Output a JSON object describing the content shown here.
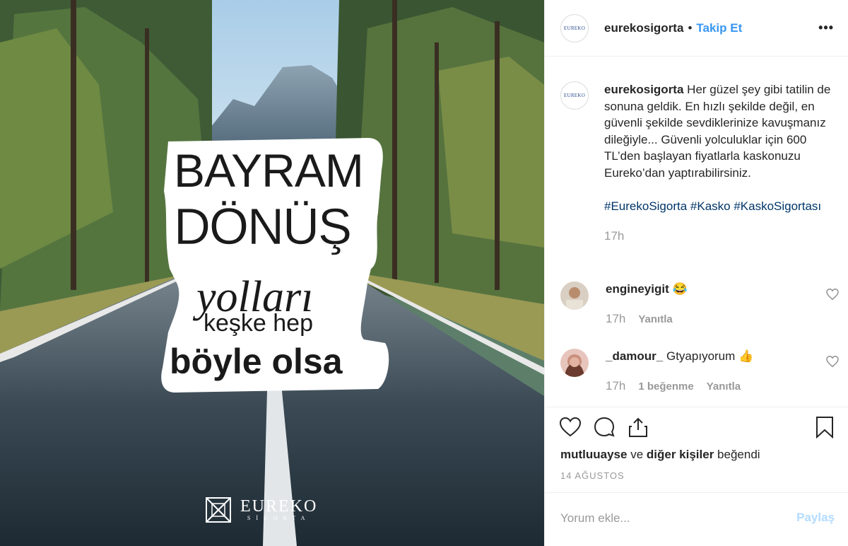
{
  "post": {
    "image_text": {
      "line1": "BAYRAM",
      "line2": "DÖNÜŞ",
      "line3": "yolları",
      "line4": "keşke hep",
      "line5": "böyle olsa"
    },
    "brand": {
      "name": "EUREKO",
      "sub": "SİGORTA"
    }
  },
  "header": {
    "avatar_text": "EUREKO",
    "username": "eurekosigorta",
    "separator": "•",
    "follow_label": "Takip Et",
    "more_icon": "more-horizontal-icon",
    "more_glyph": "•••"
  },
  "caption": {
    "username": "eurekosigorta",
    "text": "Her güzel şey gibi tatilin de sonuna geldik. En hızlı şekilde değil, en güvenli şekilde sevdiklerinize kavuşmanız dileğiyle... Güvenli yolculuklar için 600 TL’den başlayan fiyatlarla kaskonuzu Eureko’dan yaptırabilirsiniz.",
    "hashtags": "#EurekoSigorta #Kasko #KaskoSigortası",
    "time": "17h"
  },
  "comments": [
    {
      "username": "engineyigit",
      "text": "😂",
      "time": "17h",
      "likes": "",
      "reply_label": "Yanıtla"
    },
    {
      "username": "_damour_",
      "text": "Gtyapıyorum 👍",
      "time": "17h",
      "likes": "1 beğenme",
      "reply_label": "Yanıtla"
    }
  ],
  "actions": {
    "likes_user": "mutluuayse",
    "likes_conj": " ve ",
    "likes_others": "diğer kişiler",
    "likes_suffix": " beğendi",
    "date": "14 AĞUSTOS"
  },
  "add_comment": {
    "placeholder": "Yorum ekle...",
    "share_label": "Paylaş"
  },
  "colors": {
    "link_blue": "#3897f0",
    "hashtag_blue": "#003569",
    "disabled_blue": "#b3dbff"
  }
}
